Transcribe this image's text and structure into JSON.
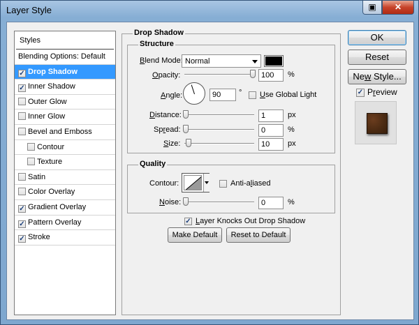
{
  "window": {
    "title": "Layer Style"
  },
  "styles_list": {
    "header": "Styles",
    "items": [
      {
        "label": "Blending Options: Default",
        "checkbox": false,
        "checked": false,
        "indent": false,
        "selected": false
      },
      {
        "label": "Drop Shadow",
        "checkbox": true,
        "checked": true,
        "indent": false,
        "selected": true
      },
      {
        "label": "Inner Shadow",
        "checkbox": true,
        "checked": true,
        "indent": false,
        "selected": false
      },
      {
        "label": "Outer Glow",
        "checkbox": true,
        "checked": false,
        "indent": false,
        "selected": false
      },
      {
        "label": "Inner Glow",
        "checkbox": true,
        "checked": false,
        "indent": false,
        "selected": false
      },
      {
        "label": "Bevel and Emboss",
        "checkbox": true,
        "checked": false,
        "indent": false,
        "selected": false
      },
      {
        "label": "Contour",
        "checkbox": true,
        "checked": false,
        "indent": true,
        "selected": false
      },
      {
        "label": "Texture",
        "checkbox": true,
        "checked": false,
        "indent": true,
        "selected": false
      },
      {
        "label": "Satin",
        "checkbox": true,
        "checked": false,
        "indent": false,
        "selected": false
      },
      {
        "label": "Color Overlay",
        "checkbox": true,
        "checked": false,
        "indent": false,
        "selected": false
      },
      {
        "label": "Gradient Overlay",
        "checkbox": true,
        "checked": true,
        "indent": false,
        "selected": false
      },
      {
        "label": "Pattern Overlay",
        "checkbox": true,
        "checked": true,
        "indent": false,
        "selected": false
      },
      {
        "label": "Stroke",
        "checkbox": true,
        "checked": true,
        "indent": false,
        "selected": false
      }
    ]
  },
  "drop_shadow": {
    "title": "Drop Shadow",
    "structure": {
      "title": "Structure",
      "blend_mode": {
        "label_pre": "B",
        "label_post": "lend Mode:",
        "value": "Normal",
        "color": "#000000"
      },
      "opacity": {
        "label_pre": "O",
        "label_post": "pacity:",
        "value": "100",
        "unit": "%",
        "level": 1.0
      },
      "angle": {
        "label_pre": "A",
        "label_post": "ngle:",
        "value": "90",
        "unit": "°",
        "use_global_light": {
          "label_pre": "U",
          "label_post": "se Global Light",
          "checked": false
        }
      },
      "distance": {
        "label_pre": "D",
        "label_post": "istance:",
        "value": "1",
        "unit": "px",
        "level": 0.0
      },
      "spread": {
        "label_pre": "Sp",
        "label_mid": "r",
        "label_post": "ead:",
        "value": "0",
        "unit": "%",
        "level": 0.0
      },
      "size": {
        "label_pre": "S",
        "label_post": "ize:",
        "value": "10",
        "unit": "px",
        "level": 0.04
      }
    },
    "quality": {
      "title": "Quality",
      "contour": {
        "label": "Contour:",
        "anti_aliased": {
          "label_pre": "Anti-a",
          "label_u": "l",
          "label_post": "iased",
          "checked": false
        }
      },
      "noise": {
        "label_pre": "N",
        "label_post": "oise:",
        "value": "0",
        "unit": "%",
        "level": 0.0
      }
    },
    "layer_knocks_out": {
      "label_pre": "",
      "label_u": "L",
      "label_post": "ayer Knocks Out Drop Shadow",
      "checked": true
    },
    "make_default": "Make Default",
    "reset_to_default": "Reset to Default"
  },
  "buttons": {
    "ok": "OK",
    "reset": "Reset",
    "new_style_pre": "Ne",
    "new_style_u": "w",
    "new_style_post": " Style...",
    "preview_pre": "P",
    "preview_u": "r",
    "preview_post": "eview",
    "preview_checked": true
  }
}
